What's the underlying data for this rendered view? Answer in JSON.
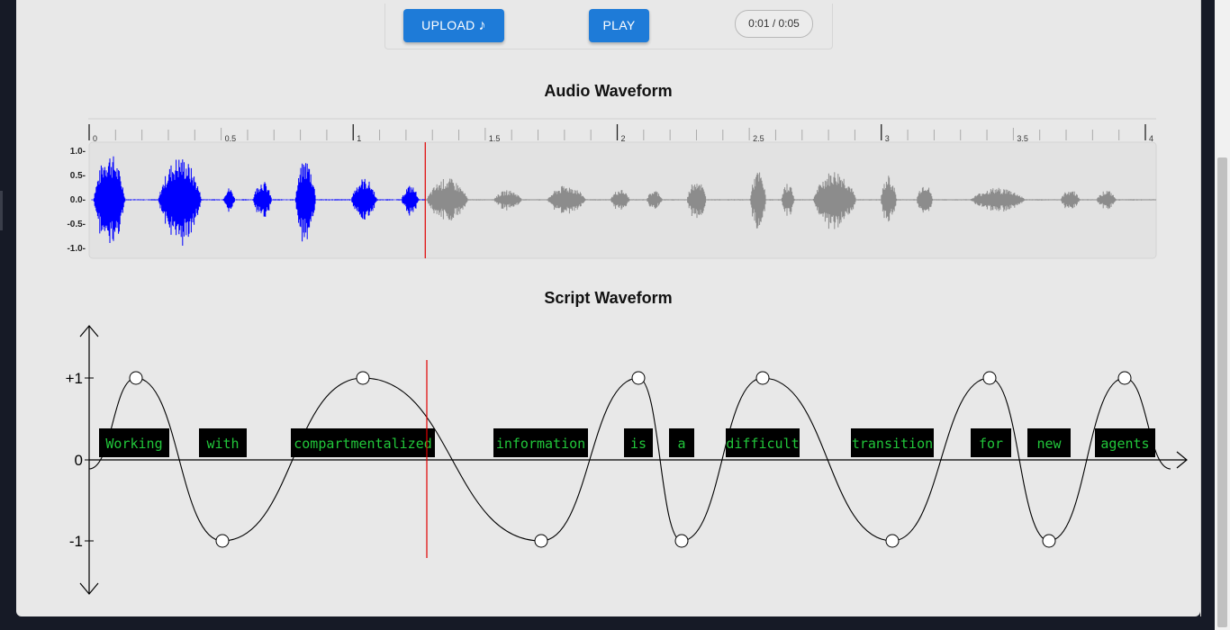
{
  "controls": {
    "upload_label": "UPLOAD",
    "upload_icon": "music-note-icon",
    "play_label": "PLAY",
    "time_display": "0:01 / 0:05"
  },
  "audio_waveform": {
    "title": "Audio Waveform",
    "ruler_labels": [
      "0",
      "0.5",
      "1",
      "1.5",
      "2",
      "2.5",
      "3",
      "3.5",
      "4"
    ],
    "y_tick_labels": [
      "1.0",
      "0.5",
      "0.0",
      "-0.5",
      "-1.0"
    ],
    "played_fraction": 0.315,
    "played_color": "#0000ff",
    "unplayed_color": "#8c8c8c",
    "playhead_color": "#e00000"
  },
  "script_waveform": {
    "title": "Script Waveform",
    "y_tick_labels": [
      "+1",
      "0",
      "-1"
    ],
    "words": [
      "Working",
      "with",
      "compartmentalized",
      "information",
      "is",
      "a",
      "difficult",
      "transition",
      "for",
      "new",
      "agents"
    ],
    "word_text_color": "#21c63a",
    "word_box_color": "#000000",
    "playhead_color": "#e00000"
  }
}
